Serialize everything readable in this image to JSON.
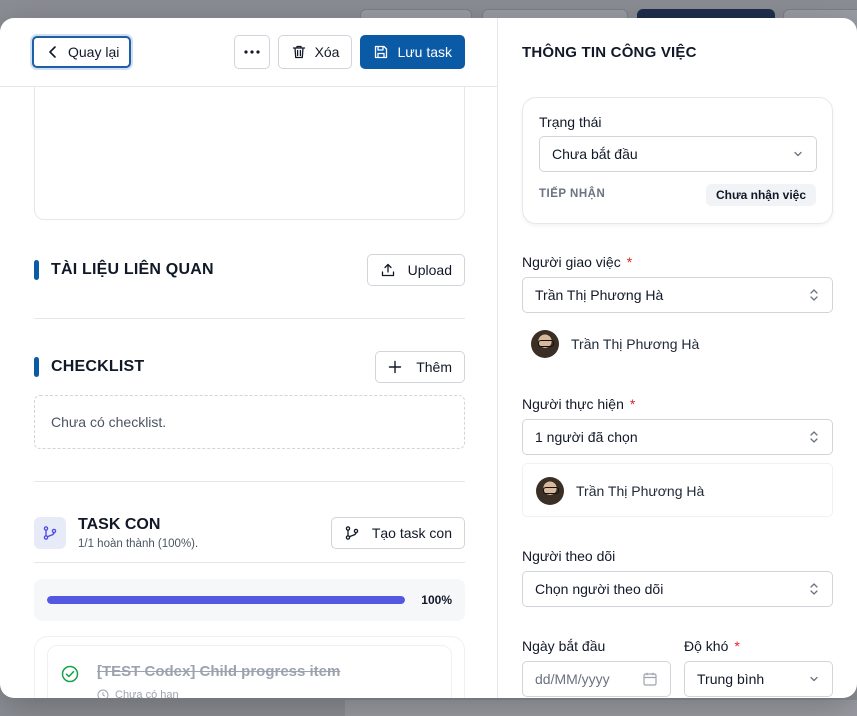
{
  "toolbar": {
    "back_label": "Quay lại",
    "delete_label": "Xóa",
    "save_label": "Lưu task"
  },
  "documents": {
    "title": "TÀI LIỆU LIÊN QUAN",
    "upload_label": "Upload"
  },
  "checklist": {
    "title": "CHECKLIST",
    "add_label": "Thêm",
    "empty_text": "Chưa có checklist."
  },
  "subtasks": {
    "title": "TASK CON",
    "meta": "1/1 hoàn thành (100%).",
    "create_label": "Tạo task con",
    "progress": 100,
    "progress_label": "100%",
    "items": [
      {
        "title": "[TEST Codex] Child progress item",
        "due": "Chưa có hạn"
      }
    ]
  },
  "info": {
    "title": "THÔNG TIN CÔNG VIỆC",
    "status": {
      "label": "Trạng thái",
      "value": "Chưa bắt đầu",
      "receive_label": "TIẾP NHẬN",
      "receive_value": "Chưa nhận việc"
    },
    "assigner": {
      "label": "Người giao việc",
      "value": "Trần Thị Phương Hà",
      "person": "Trần Thị Phương Hà"
    },
    "assignee": {
      "label": "Người thực hiện",
      "value": "1 người đã chọn",
      "person": "Trần Thị Phương Hà"
    },
    "watchers": {
      "label": "Người theo dõi",
      "placeholder": "Chọn người theo dõi"
    },
    "start_date": {
      "label": "Ngày bắt đầu",
      "placeholder": "dd/MM/yyyy"
    },
    "difficulty": {
      "label": "Độ khó",
      "value": "Trung bình"
    }
  },
  "colors": {
    "primary": "#0b5aa6",
    "progress": "#5457e0",
    "required": "#dc2626",
    "success": "#16a34a"
  }
}
